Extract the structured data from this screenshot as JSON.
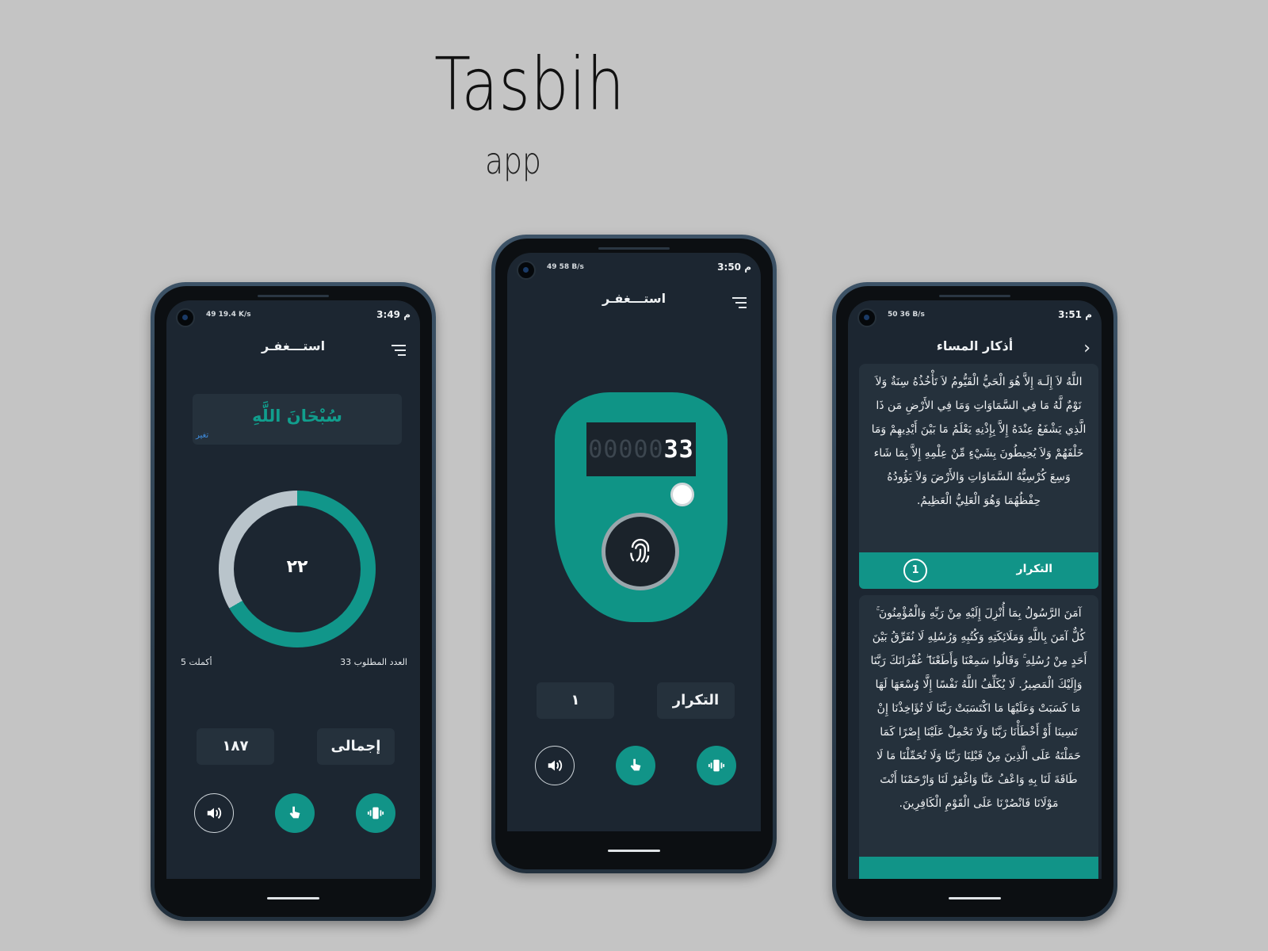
{
  "hero": {
    "title": "Tasbih",
    "subtitle": "app"
  },
  "colors": {
    "accent": "#119488",
    "screen_bg": "#1c2631",
    "card_bg": "#25313c",
    "page_bg": "#c4c4c4"
  },
  "phone1": {
    "status_time": "3:49 م",
    "status_left": "49 19.4 K/s",
    "title": "استـــغفـر",
    "zikr": "سُبْحَانَ اللَّهِ",
    "change_link": "تغير",
    "counter": "٢٢",
    "progress_fraction": 0.67,
    "completed_label": "أكملت 5",
    "target_label": "العدد المطلوب 33",
    "total_value": "١٨٧",
    "total_label": "إجمالى",
    "icons": [
      "speaker-icon",
      "tap-icon",
      "vibrate-icon"
    ]
  },
  "phone2": {
    "status_time": "3:50 م",
    "status_left": "49 58 B/s",
    "title": "استـــغفـر",
    "lcd_dim": "00000",
    "lcd_value": "33",
    "repeat_value": "١",
    "repeat_label": "التكرار",
    "icons": [
      "speaker-icon",
      "tap-icon",
      "vibrate-icon"
    ]
  },
  "phone3": {
    "status_time": "3:51 م",
    "status_left": "50 36 B/s",
    "title": "أذكار المساء",
    "cards": [
      {
        "text": "اللَّهُ لاَ إِلَـهَ إِلاَّ هُوَ الْحَيُّ الْقَيُّومُ لاَ تَأْخُذُهُ سِنَةٌ وَلاَ نَوْمٌ لَّهُ مَا فِي السَّمَاوَاتِ وَمَا فِي الأَرْضِ مَن ذَا الَّذِي يَشْفَعُ عِنْدَهُ إِلاَّ بِإِذْنِهِ يَعْلَمُ مَا بَيْنَ أَيْدِيهِمْ وَمَا خَلْفَهُمْ وَلاَ يُحِيطُونَ بِشَيْءٍ مِّنْ عِلْمِهِ إِلاَّ بِمَا شَاء وَسِعَ كُرْسِيُّهُ السَّمَاوَاتِ وَالأَرْضَ وَلاَ يَؤُودُهُ حِفْظُهُمَا وَهُوَ الْعَلِيُّ الْعَظِيمُ.",
        "repeat_label": "التكرار",
        "repeat_count": "1"
      },
      {
        "text": "آمَنَ الرَّسُولُ بِمَا أُنْزِلَ إِلَيْهِ مِنْ رَبِّهِ وَالْمُؤْمِنُونَ ۚ كُلٌّ آمَنَ بِاللَّهِ وَمَلَائِكَتِهِ وَكُتُبِهِ وَرُسُلِهِ لَا نُفَرِّقُ بَيْنَ أَحَدٍ مِنْ رُسُلِهِ ۚ وَقَالُوا سَمِعْنَا وَأَطَعْنَا ۖ غُفْرَانَكَ رَبَّنَا وَإِلَيْكَ الْمَصِيرُ. لَا يُكَلِّفُ اللَّهُ نَفْسًا إِلَّا وُسْعَهَا لَهَا مَا كَسَبَتْ وَعَلَيْهَا مَا اكْتَسَبَتْ رَبَّنَا لَا تُؤَاخِذْنَا إِنْ نَسِينَا أَوْ أَخْطَأْنَا رَبَّنَا وَلَا تَحْمِلْ عَلَيْنَا إِصْرًا كَمَا حَمَلْتَهُ عَلَى الَّذِينَ مِنْ قَبْلِنَا رَبَّنَا وَلَا تُحَمِّلْنَا مَا لَا طَاقَةَ لَنَا بِهِ وَاعْفُ عَنَّا وَاغْفِرْ لَنَا وَارْحَمْنَا أَنْتَ مَوْلَانَا فَانْصُرْنَا عَلَى الْقَوْمِ الْكَافِرِينَ."
      }
    ]
  }
}
